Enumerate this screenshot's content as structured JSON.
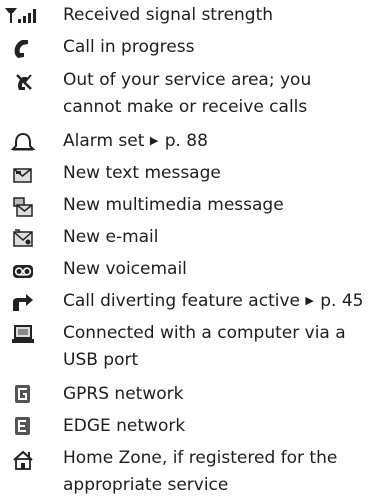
{
  "indicators": [
    {
      "icon": "signal-strength-icon",
      "lines": [
        "Received signal strength"
      ]
    },
    {
      "icon": "call-in-progress-icon",
      "lines": [
        "Call in progress"
      ]
    },
    {
      "icon": "no-service-icon",
      "lines": [
        "Out of your service area; you",
        "cannot make or receive calls"
      ]
    },
    {
      "icon": "alarm-bell-icon",
      "text_before_arrow": "Alarm set",
      "arrow": "▶",
      "page_ref": "p. 88"
    },
    {
      "icon": "text-message-icon",
      "lines": [
        "New text message"
      ]
    },
    {
      "icon": "multimedia-message-icon",
      "lines": [
        "New multimedia message"
      ]
    },
    {
      "icon": "email-icon",
      "lines": [
        "New e-mail"
      ]
    },
    {
      "icon": "voicemail-icon",
      "lines": [
        "New voicemail"
      ]
    },
    {
      "icon": "call-divert-icon",
      "text_before_arrow": "Call diverting feature active",
      "arrow": "▶",
      "page_ref": "p. 45"
    },
    {
      "icon": "computer-connection-icon",
      "lines": [
        "Connected with a computer via a",
        "USB port"
      ]
    },
    {
      "icon": "gprs-icon",
      "lines": [
        "GPRS network"
      ]
    },
    {
      "icon": "edge-icon",
      "lines": [
        "EDGE network"
      ]
    },
    {
      "icon": "home-zone-icon",
      "lines": [
        "Home Zone, if registered for the",
        "appropriate service"
      ]
    }
  ]
}
